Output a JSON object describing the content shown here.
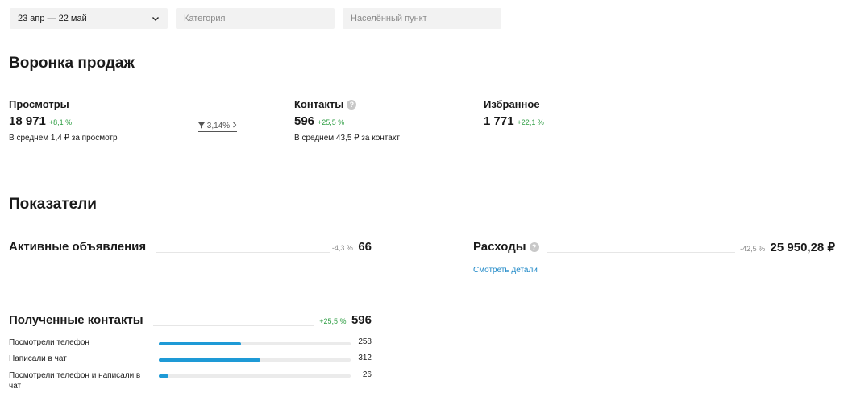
{
  "filters": {
    "period": "23 апр — 22 май",
    "category_placeholder": "Категория",
    "locality_placeholder": "Населённый пункт"
  },
  "funnel": {
    "title": "Воронка продаж",
    "views": {
      "label": "Просмотры",
      "value": "18 971",
      "delta": "+8,1 %",
      "sub": "В среднем 1,4 ₽ за просмотр"
    },
    "conversion": "3,14%",
    "contacts": {
      "label": "Контакты",
      "value": "596",
      "delta": "+25,5 %",
      "sub": "В среднем 43,5 ₽ за контакт"
    },
    "favorites": {
      "label": "Избранное",
      "value": "1 771",
      "delta": "+22,1 %"
    }
  },
  "indicators": {
    "title": "Показатели",
    "active_ads": {
      "label": "Активные объявления",
      "delta": "-4,3 %",
      "value": "66"
    },
    "expenses": {
      "label": "Расходы",
      "delta": "-42,5 %",
      "value": "25 950,28 ₽",
      "link": "Смотреть детали"
    },
    "received_contacts": {
      "label": "Полученные контакты",
      "delta": "+25,5 %",
      "value": "596",
      "rows": [
        {
          "label": "Посмотрели телефон",
          "value": "258",
          "fraction": 0.43
        },
        {
          "label": "Написали в чат",
          "value": "312",
          "fraction": 0.53
        },
        {
          "label": "Посмотрели телефон и написали в чат",
          "value": "26",
          "fraction": 0.05
        }
      ]
    }
  },
  "colors": {
    "accent": "#1e9ad6",
    "positive": "#2f9e44",
    "link": "#1e88c7"
  },
  "icons": {
    "dropdown": "chevron-down-icon",
    "help": "question-icon",
    "funnel": "filter-icon"
  }
}
